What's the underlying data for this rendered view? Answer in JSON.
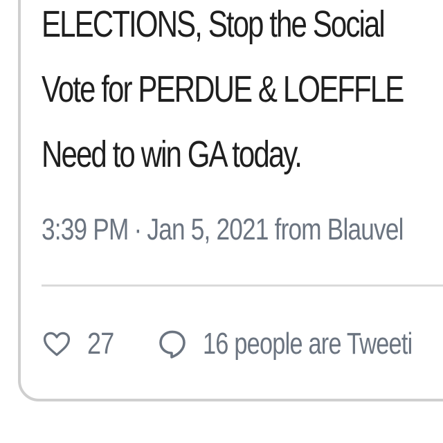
{
  "tweet": {
    "lines": [
      "ELECTIONS, Stop the Social",
      "Vote for PERDUE & LOEFFLE",
      "Need to win GA today."
    ],
    "time": "3:39 PM",
    "separator": "·",
    "date": "Jan 5, 2021",
    "source": "from Blauvel"
  },
  "actions": {
    "like_icon": "heart-icon",
    "like_count": "27",
    "reply_icon": "speech-bubble-icon",
    "conversation_text": "16 people are Tweeti"
  },
  "colors": {
    "text": "#1f1f1f",
    "secondary": "#6b7480",
    "border": "#cfcfcf"
  }
}
